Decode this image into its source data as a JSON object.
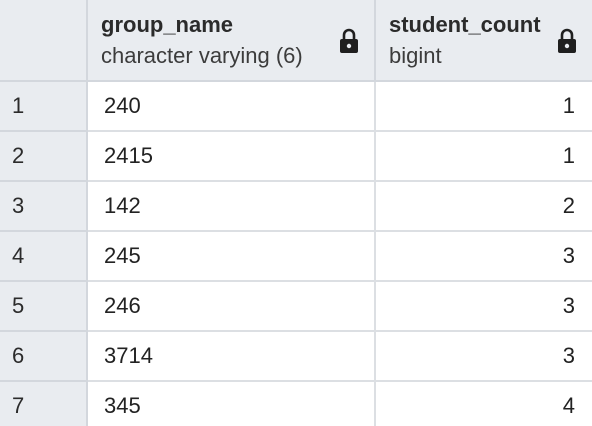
{
  "columns": [
    {
      "name": "group_name",
      "type": "character varying (6)",
      "icon": "lock-icon"
    },
    {
      "name": "student_count",
      "type": "bigint",
      "icon": "lock-icon"
    }
  ],
  "rows": [
    {
      "num": "1",
      "group_name": "240",
      "student_count": "1"
    },
    {
      "num": "2",
      "group_name": "2415",
      "student_count": "1"
    },
    {
      "num": "3",
      "group_name": "142",
      "student_count": "2"
    },
    {
      "num": "4",
      "group_name": "245",
      "student_count": "3"
    },
    {
      "num": "5",
      "group_name": "246",
      "student_count": "3"
    },
    {
      "num": "6",
      "group_name": "3714",
      "student_count": "3"
    },
    {
      "num": "7",
      "group_name": "345",
      "student_count": "4"
    }
  ],
  "colors": {
    "header_bg": "#e9ecf0",
    "cell_bg": "#ffffff",
    "grid_line": "#dcdfe3"
  }
}
